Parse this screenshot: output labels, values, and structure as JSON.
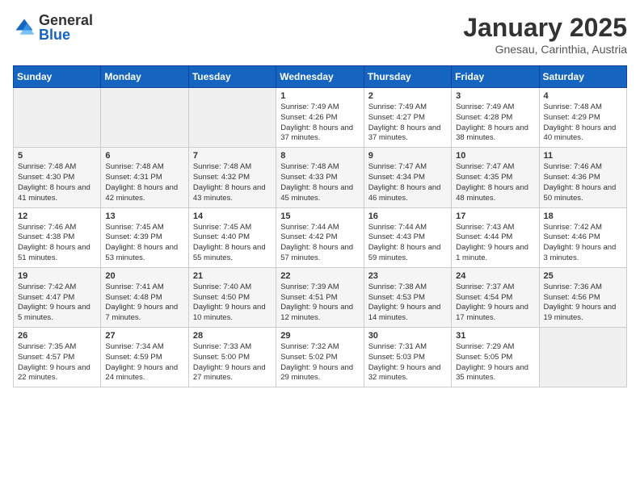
{
  "header": {
    "logo_general": "General",
    "logo_blue": "Blue",
    "month": "January 2025",
    "location": "Gnesau, Carinthia, Austria"
  },
  "days_of_week": [
    "Sunday",
    "Monday",
    "Tuesday",
    "Wednesday",
    "Thursday",
    "Friday",
    "Saturday"
  ],
  "weeks": [
    [
      {
        "day": "",
        "info": ""
      },
      {
        "day": "",
        "info": ""
      },
      {
        "day": "",
        "info": ""
      },
      {
        "day": "1",
        "info": "Sunrise: 7:49 AM\nSunset: 4:26 PM\nDaylight: 8 hours and 37 minutes."
      },
      {
        "day": "2",
        "info": "Sunrise: 7:49 AM\nSunset: 4:27 PM\nDaylight: 8 hours and 37 minutes."
      },
      {
        "day": "3",
        "info": "Sunrise: 7:49 AM\nSunset: 4:28 PM\nDaylight: 8 hours and 38 minutes."
      },
      {
        "day": "4",
        "info": "Sunrise: 7:48 AM\nSunset: 4:29 PM\nDaylight: 8 hours and 40 minutes."
      }
    ],
    [
      {
        "day": "5",
        "info": "Sunrise: 7:48 AM\nSunset: 4:30 PM\nDaylight: 8 hours and 41 minutes."
      },
      {
        "day": "6",
        "info": "Sunrise: 7:48 AM\nSunset: 4:31 PM\nDaylight: 8 hours and 42 minutes."
      },
      {
        "day": "7",
        "info": "Sunrise: 7:48 AM\nSunset: 4:32 PM\nDaylight: 8 hours and 43 minutes."
      },
      {
        "day": "8",
        "info": "Sunrise: 7:48 AM\nSunset: 4:33 PM\nDaylight: 8 hours and 45 minutes."
      },
      {
        "day": "9",
        "info": "Sunrise: 7:47 AM\nSunset: 4:34 PM\nDaylight: 8 hours and 46 minutes."
      },
      {
        "day": "10",
        "info": "Sunrise: 7:47 AM\nSunset: 4:35 PM\nDaylight: 8 hours and 48 minutes."
      },
      {
        "day": "11",
        "info": "Sunrise: 7:46 AM\nSunset: 4:36 PM\nDaylight: 8 hours and 50 minutes."
      }
    ],
    [
      {
        "day": "12",
        "info": "Sunrise: 7:46 AM\nSunset: 4:38 PM\nDaylight: 8 hours and 51 minutes."
      },
      {
        "day": "13",
        "info": "Sunrise: 7:45 AM\nSunset: 4:39 PM\nDaylight: 8 hours and 53 minutes."
      },
      {
        "day": "14",
        "info": "Sunrise: 7:45 AM\nSunset: 4:40 PM\nDaylight: 8 hours and 55 minutes."
      },
      {
        "day": "15",
        "info": "Sunrise: 7:44 AM\nSunset: 4:42 PM\nDaylight: 8 hours and 57 minutes."
      },
      {
        "day": "16",
        "info": "Sunrise: 7:44 AM\nSunset: 4:43 PM\nDaylight: 8 hours and 59 minutes."
      },
      {
        "day": "17",
        "info": "Sunrise: 7:43 AM\nSunset: 4:44 PM\nDaylight: 9 hours and 1 minute."
      },
      {
        "day": "18",
        "info": "Sunrise: 7:42 AM\nSunset: 4:46 PM\nDaylight: 9 hours and 3 minutes."
      }
    ],
    [
      {
        "day": "19",
        "info": "Sunrise: 7:42 AM\nSunset: 4:47 PM\nDaylight: 9 hours and 5 minutes."
      },
      {
        "day": "20",
        "info": "Sunrise: 7:41 AM\nSunset: 4:48 PM\nDaylight: 9 hours and 7 minutes."
      },
      {
        "day": "21",
        "info": "Sunrise: 7:40 AM\nSunset: 4:50 PM\nDaylight: 9 hours and 10 minutes."
      },
      {
        "day": "22",
        "info": "Sunrise: 7:39 AM\nSunset: 4:51 PM\nDaylight: 9 hours and 12 minutes."
      },
      {
        "day": "23",
        "info": "Sunrise: 7:38 AM\nSunset: 4:53 PM\nDaylight: 9 hours and 14 minutes."
      },
      {
        "day": "24",
        "info": "Sunrise: 7:37 AM\nSunset: 4:54 PM\nDaylight: 9 hours and 17 minutes."
      },
      {
        "day": "25",
        "info": "Sunrise: 7:36 AM\nSunset: 4:56 PM\nDaylight: 9 hours and 19 minutes."
      }
    ],
    [
      {
        "day": "26",
        "info": "Sunrise: 7:35 AM\nSunset: 4:57 PM\nDaylight: 9 hours and 22 minutes."
      },
      {
        "day": "27",
        "info": "Sunrise: 7:34 AM\nSunset: 4:59 PM\nDaylight: 9 hours and 24 minutes."
      },
      {
        "day": "28",
        "info": "Sunrise: 7:33 AM\nSunset: 5:00 PM\nDaylight: 9 hours and 27 minutes."
      },
      {
        "day": "29",
        "info": "Sunrise: 7:32 AM\nSunset: 5:02 PM\nDaylight: 9 hours and 29 minutes."
      },
      {
        "day": "30",
        "info": "Sunrise: 7:31 AM\nSunset: 5:03 PM\nDaylight: 9 hours and 32 minutes."
      },
      {
        "day": "31",
        "info": "Sunrise: 7:29 AM\nSunset: 5:05 PM\nDaylight: 9 hours and 35 minutes."
      },
      {
        "day": "",
        "info": ""
      }
    ]
  ]
}
